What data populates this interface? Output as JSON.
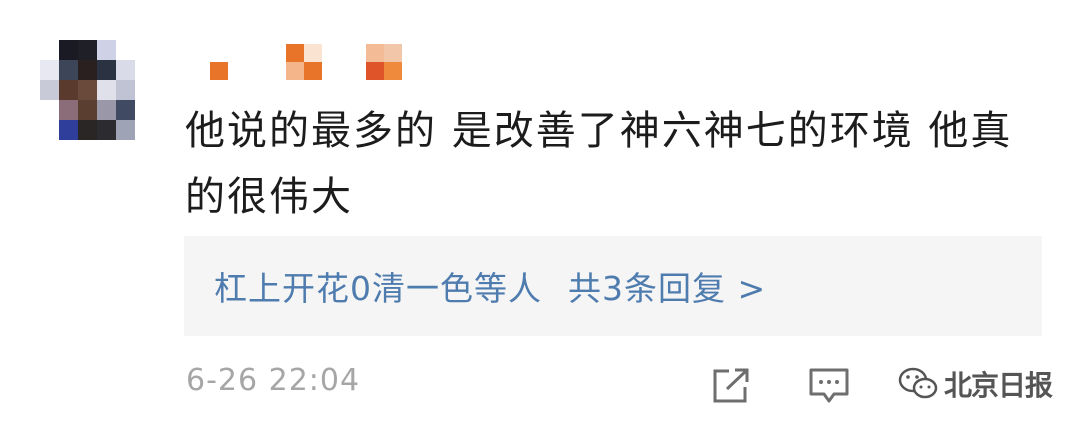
{
  "comment": {
    "text": "他说的最多的 是改善了神六神七的环境  他真的很伟大",
    "timestamp": "6-26 22:04"
  },
  "replies": {
    "names": "杠上开花0清一色等人",
    "count_label": "共3条回复 >"
  },
  "actions": {
    "share_icon": "share-icon",
    "reply_icon": "comment-icon"
  },
  "watermark": {
    "logo": "wechat-icon",
    "text": "北京日报"
  },
  "colors": {
    "text": "#1c1c1c",
    "link": "#4f7cae",
    "muted": "#a6a6a6",
    "reply_bg": "#f5f5f5",
    "username_pixels": "#e8742a"
  }
}
